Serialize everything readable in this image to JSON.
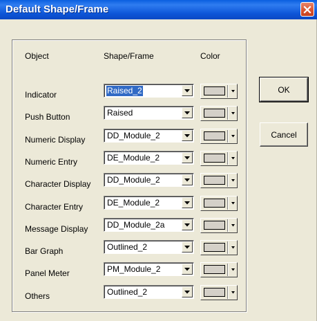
{
  "window": {
    "title": "Default Shape/Frame"
  },
  "columns": {
    "object": "Object",
    "shape": "Shape/Frame",
    "color": "Color"
  },
  "rows": [
    {
      "label": "Indicator",
      "shape": "Raised_2"
    },
    {
      "label": "Push Button",
      "shape": "Raised"
    },
    {
      "label": "Numeric Display",
      "shape": "DD_Module_2"
    },
    {
      "label": "Numeric Entry",
      "shape": "DE_Module_2"
    },
    {
      "label": "Character Display",
      "shape": "DD_Module_2"
    },
    {
      "label": "Character Entry",
      "shape": "DE_Module_2"
    },
    {
      "label": "Message Display",
      "shape": "DD_Module_2a"
    },
    {
      "label": "Bar Graph",
      "shape": "Outlined_2"
    },
    {
      "label": "Panel Meter",
      "shape": "PM_Module_2"
    },
    {
      "label": "Others",
      "shape": "Outlined_2"
    }
  ],
  "buttons": {
    "ok": "OK",
    "cancel": "Cancel"
  },
  "colors": {
    "titlebar": "#0A5FE0",
    "dialog_bg": "#ECE9D8",
    "selection": "#316AC5",
    "swatch": "#D4D0C8",
    "close": "#D9522E"
  },
  "icons": {
    "close": "close-icon",
    "dropdown": "chevron-down-icon"
  }
}
